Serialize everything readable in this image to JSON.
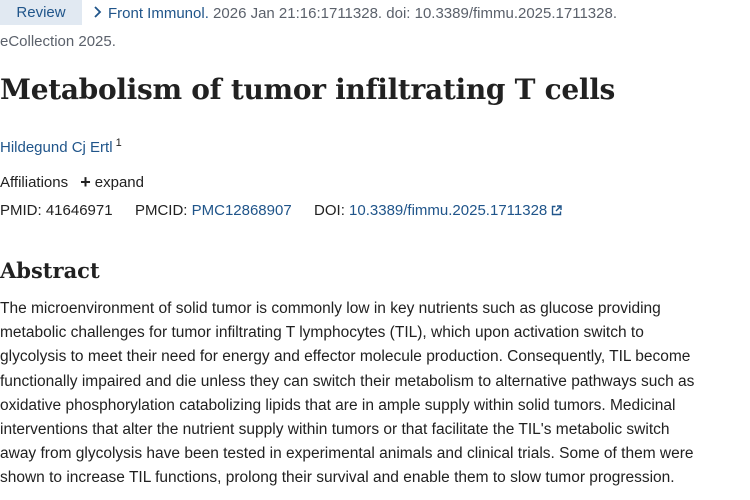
{
  "citation": {
    "badge": "Review",
    "journal": "Front Immunol.",
    "pub_info": " 2026 Jan 21:16:1711328. doi: 10.3389/fimmu.2025.1711328.",
    "ecollection": "eCollection 2025."
  },
  "article": {
    "title": "Metabolism of tumor infiltrating T cells",
    "authors": [
      {
        "name": "Hildegund Cj Ertl",
        "affiliation_ref": "1"
      }
    ],
    "affiliations_label": "Affiliations",
    "expand_label": "expand"
  },
  "identifiers": {
    "pmid_label": "PMID:",
    "pmid": "41646971",
    "pmcid_label": "PMCID:",
    "pmcid": "PMC12868907",
    "doi_label": "DOI:",
    "doi": "10.3389/fimmu.2025.1711328"
  },
  "abstract": {
    "heading": "Abstract",
    "lines": [
      "The microenvironment of solid tumor is commonly low in key nutrients such as glucose providing",
      "metabolic challenges for tumor infiltrating T lymphocytes (TIL), which upon activation switch to",
      "glycolysis to meet their need for energy and effector molecule production. Consequently, TIL become",
      "functionally impaired and die unless they can switch their metabolism to alternative pathways such as",
      "oxidative phosphorylation catabolizing lipids that are in ample supply within solid tumors. Medicinal",
      "interventions that alter the nutrient supply within tumors or that facilitate the TIL's metabolic switch",
      "away from glycolysis have been tested in experimental animals and clinical trials. Some of them were",
      "shown to increase TIL functions, prolong their survival and enable them to slow tumor progression."
    ]
  },
  "icons": {
    "chevron": "chevron-right-icon",
    "expand": "plus-icon",
    "external": "external-link-icon"
  },
  "colors": {
    "link": "#20558a",
    "badge_bg": "#e1e9f2",
    "muted": "#5b616b",
    "text": "#212121"
  }
}
